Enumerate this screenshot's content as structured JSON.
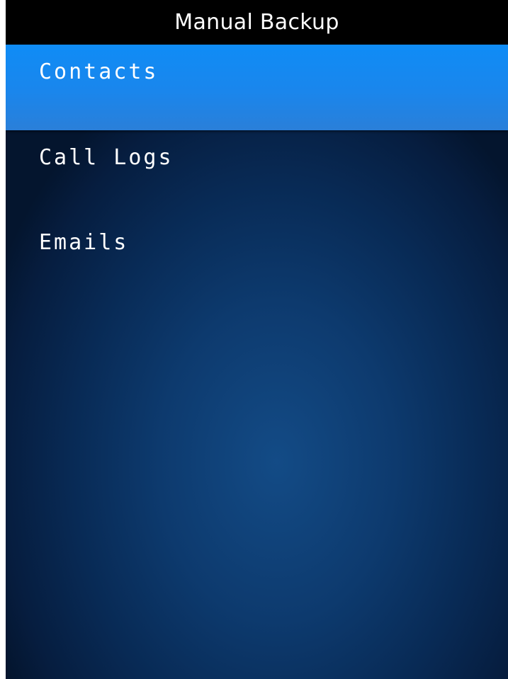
{
  "header": {
    "title": "Manual Backup"
  },
  "menu": {
    "selected_index": 0,
    "items": [
      {
        "label": "Contacts"
      },
      {
        "label": "Call Logs"
      },
      {
        "label": "Emails"
      }
    ]
  },
  "colors": {
    "titlebar_bg": "#000000",
    "selection_accent": "#0f8cf6",
    "background_dark": "#04152e",
    "background_light": "#134b86",
    "text": "#ffffff"
  }
}
